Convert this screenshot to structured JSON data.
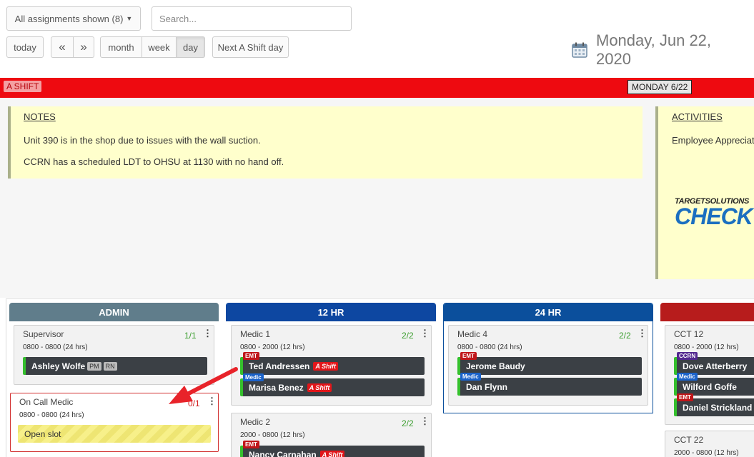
{
  "toolbar": {
    "assignments_label": "All assignments shown (8)",
    "search_placeholder": "Search...",
    "today": "today",
    "prev": "«",
    "next": "»",
    "views": [
      "month",
      "week",
      "day"
    ],
    "active_view": "day",
    "next_shift": "Next A Shift day"
  },
  "date_title": "Monday, Jun 22, 2020",
  "shift": {
    "label": "A SHIFT",
    "day": "MONDAY 6/22"
  },
  "notes": {
    "heading": "NOTES",
    "lines": [
      "Unit 390 is in the shop due to issues with the wall suction.",
      "CCRN has a scheduled LDT to OHSU at 1130 with no hand off."
    ]
  },
  "activities": {
    "heading": "ACTIVITIES",
    "line": "Employee Appreciat",
    "logo_small": "TARGETSOLUTIONS",
    "logo_big": "CHECK"
  },
  "columns": [
    {
      "title": "ADMIN",
      "color": "#607d8b"
    },
    {
      "title": "12 HR",
      "color": "#0d47a1"
    },
    {
      "title": "24 HR",
      "color": "#0b4f9c"
    },
    {
      "title": "",
      "color": "#b71c1c"
    }
  ],
  "cards": {
    "supervisor": {
      "title": "Supervisor",
      "count": "1/1",
      "time": "0800 - 0800 (24 hrs)",
      "person": "Ashley Wolfe",
      "badge1": "PM",
      "badge2": "RN"
    },
    "oncall": {
      "title": "On Call Medic",
      "count": "0/1",
      "time": "0800 - 0800 (24 hrs)",
      "slot": "Open slot"
    },
    "medic1": {
      "title": "Medic 1",
      "count": "2/2",
      "time": "0800 - 2000 (12 hrs)",
      "p1": "Ted Andressen",
      "p1_tag": "EMT",
      "p1_shift": "A Shift",
      "p2": "Marisa Benez",
      "p2_tag": "Medic",
      "p2_shift": "A Shift"
    },
    "medic2": {
      "title": "Medic 2",
      "count": "2/2",
      "time": "2000 - 0800 (12 hrs)",
      "p1": "Nancy Carnahan",
      "p1_tag": "EMT",
      "p1_shift": "A Shift"
    },
    "medic4": {
      "title": "Medic 4",
      "count": "2/2",
      "time": "0800 - 0800 (24 hrs)",
      "p1": "Jerome Baudy",
      "p1_tag": "EMT",
      "p2": "Dan Flynn",
      "p2_tag": "Medic"
    },
    "cct12": {
      "title": "CCT 12",
      "time": "0800 - 2000 (12 hrs)",
      "p1": "Dove Atterberry",
      "p1_tag": "CCRN",
      "p2": "Wilford Goffe",
      "p2_tag": "Medic",
      "p3": "Daniel Strickland",
      "p3_tag": "EMT"
    },
    "cct22": {
      "title": "CCT 22",
      "time": "2000 - 0800 (12 hrs)"
    }
  },
  "colors": {
    "shift_red": "#ee0a10",
    "notes_bg": "#ffffcc",
    "assigned_green": "#35c02d",
    "arrow_red": "#e8232a"
  }
}
